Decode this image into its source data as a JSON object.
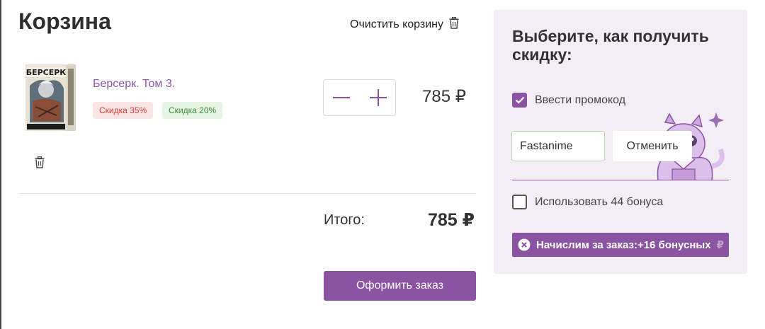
{
  "cart": {
    "title": "Корзина",
    "clear_label": "Очистить корзину",
    "item": {
      "name": "Берсерк. Том 3.",
      "cover_text": "БЕРСЕРК",
      "badges": [
        "Скидка 35%",
        "Скидка 20%"
      ],
      "price": "785 ₽"
    },
    "total_label": "Итого:",
    "total_value": "785 ₽",
    "checkout_label": "Оформить заказ"
  },
  "discount": {
    "title": "Выберите, как получить скидку:",
    "promo_checkbox_label": "Ввести промокод",
    "promo_checked": true,
    "promo_value": "Fastanime",
    "cancel_label": "Отменить",
    "bonus_checkbox_label": "Использовать 44 бонуса",
    "bonus_checked": false,
    "banner_text": "Начислим за заказ:+16 бонусных",
    "banner_currency": "₽"
  },
  "colors": {
    "accent": "#8b54a2",
    "link": "#8e58a8",
    "panel_bg": "#f3eef6",
    "discount_red": "#d23a3a",
    "discount_green": "#3a8c3a"
  },
  "icons": [
    "trash-icon",
    "minus-icon",
    "plus-icon",
    "check-icon",
    "close-circle-icon"
  ]
}
